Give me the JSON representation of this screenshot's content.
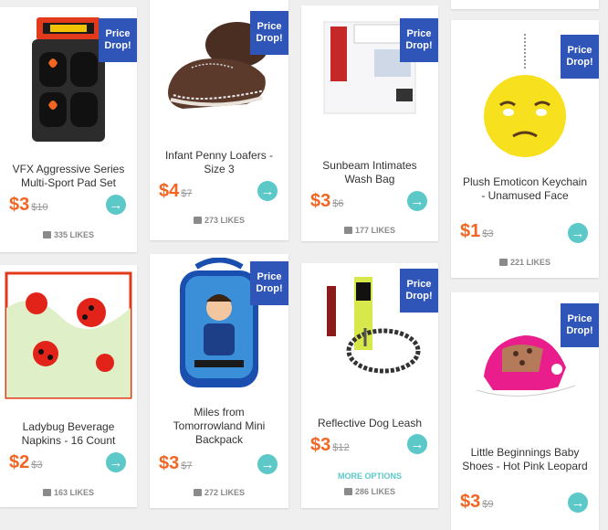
{
  "badge_text": "Price Drop!",
  "more_options": "MORE OPTIONS",
  "products": [
    {
      "title": "VFX Aggressive Series Multi-Sport Pad Set",
      "price": "$3",
      "old_price": "$10",
      "likes": "335 LIKES",
      "image": "pad-set-image"
    },
    {
      "title": "Infant Penny Loafers - Size 3",
      "price": "$4",
      "old_price": "$7",
      "likes": "273 LIKES",
      "image": "loafers-image"
    },
    {
      "title": "Sunbeam Intimates Wash Bag",
      "price": "$3",
      "old_price": "$6",
      "likes": "177 LIKES",
      "image": "wash-bag-image"
    },
    {
      "title": "Plush Emoticon Keychain - Unamused Face",
      "price": "$1",
      "old_price": "$3",
      "likes": "221 LIKES",
      "image": "keychain-image"
    },
    {
      "title": "Ladybug Beverage Napkins - 16 Count",
      "price": "$2",
      "old_price": "$3",
      "likes": "163 LIKES",
      "image": "napkins-image"
    },
    {
      "title": "Miles from Tomorrowland Mini Backpack",
      "price": "$3",
      "old_price": "$7",
      "likes": "272 LIKES",
      "image": "backpack-image"
    },
    {
      "title": "Reflective Dog Leash",
      "price": "$3",
      "old_price": "$12",
      "likes": "286 LIKES",
      "image": "leash-image"
    },
    {
      "title": "Little Beginnings Baby Shoes - Hot Pink Leopard",
      "price": "$3",
      "old_price": "$9",
      "likes": "",
      "image": "baby-shoes-image"
    }
  ]
}
